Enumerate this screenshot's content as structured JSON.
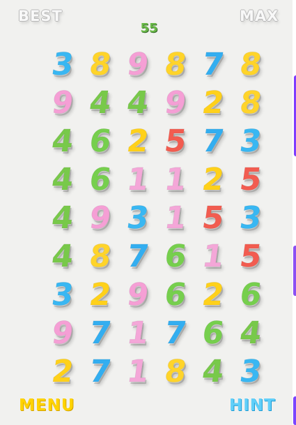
{
  "header": {
    "best_label": "BEST",
    "max_label": "MAX",
    "score": "55"
  },
  "footer": {
    "menu_label": "MENU",
    "hint_label": "HINT"
  },
  "palette": {
    "1": "#f4a7d8",
    "2": "#ffd11a",
    "3": "#39b7f2",
    "4": "#78c94a",
    "5": "#f25c50",
    "6": "#76cf4d",
    "7": "#33aef0",
    "8": "#ffd42a",
    "9": "#f59fd5"
  },
  "board": {
    "rows": [
      [
        "3",
        "8",
        "9",
        "8",
        "7",
        "8"
      ],
      [
        "9",
        "4",
        "4",
        "9",
        "2",
        "8"
      ],
      [
        "4",
        "6",
        "2",
        "5",
        "7",
        "3"
      ],
      [
        "4",
        "6",
        "1",
        "1",
        "2",
        "5"
      ],
      [
        "4",
        "9",
        "3",
        "1",
        "5",
        "3"
      ],
      [
        "4",
        "8",
        "7",
        "6",
        "1",
        "5"
      ],
      [
        "3",
        "2",
        "9",
        "6",
        "2",
        "6"
      ],
      [
        "9",
        "7",
        "1",
        "7",
        "6",
        "4"
      ],
      [
        "2",
        "7",
        "1",
        "8",
        "4",
        "3"
      ]
    ]
  }
}
